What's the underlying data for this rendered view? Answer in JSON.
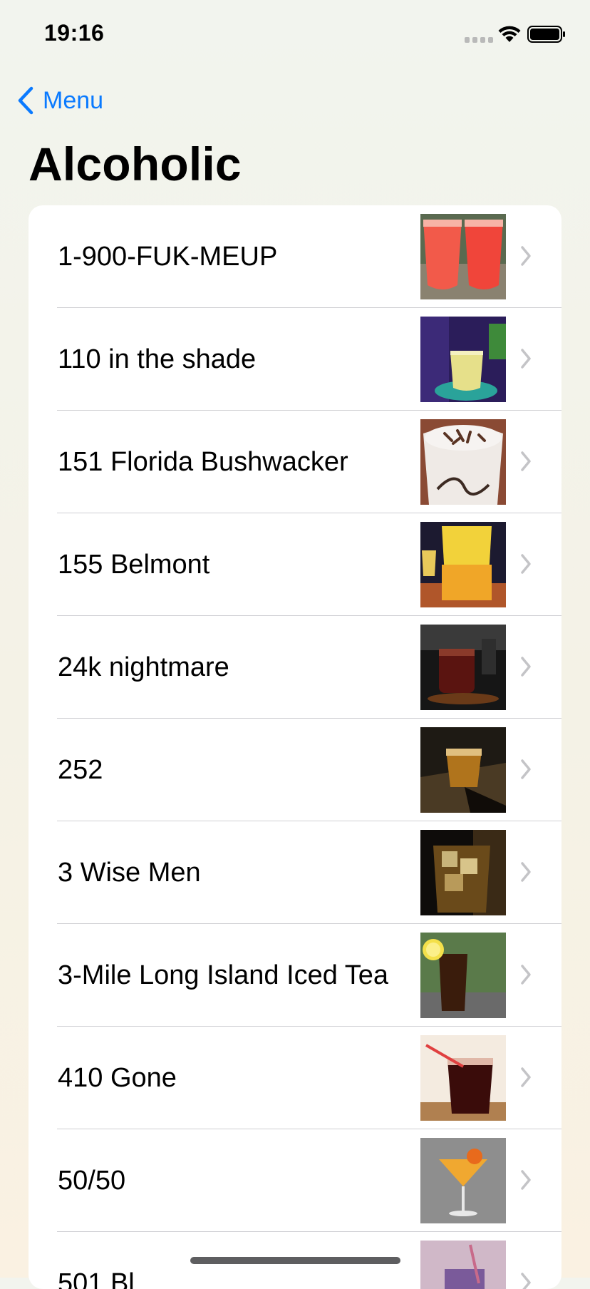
{
  "status_bar": {
    "time": "19:16"
  },
  "nav": {
    "back_label": "Menu"
  },
  "page": {
    "title": "Alcoholic"
  },
  "drinks": [
    {
      "name": "1-900-FUK-MEUP",
      "thumb_icon": "red-cocktail-photo"
    },
    {
      "name": "110 in the shade",
      "thumb_icon": "yellow-cocktail-photo"
    },
    {
      "name": "151 Florida Bushwacker",
      "thumb_icon": "chocolate-cream-drink-photo"
    },
    {
      "name": "155 Belmont",
      "thumb_icon": "orange-cocktail-photo"
    },
    {
      "name": "24k nightmare",
      "thumb_icon": "whiskey-glass-photo"
    },
    {
      "name": "252",
      "thumb_icon": "shot-glass-photo"
    },
    {
      "name": "3 Wise Men",
      "thumb_icon": "whiskey-ice-photo"
    },
    {
      "name": "3-Mile Long Island Iced Tea",
      "thumb_icon": "iced-tea-lemon-photo"
    },
    {
      "name": "410 Gone",
      "thumb_icon": "red-drink-straw-photo"
    },
    {
      "name": "50/50",
      "thumb_icon": "martini-orange-photo"
    },
    {
      "name": "501 Bl",
      "thumb_icon": "purple-drink-photo"
    }
  ]
}
